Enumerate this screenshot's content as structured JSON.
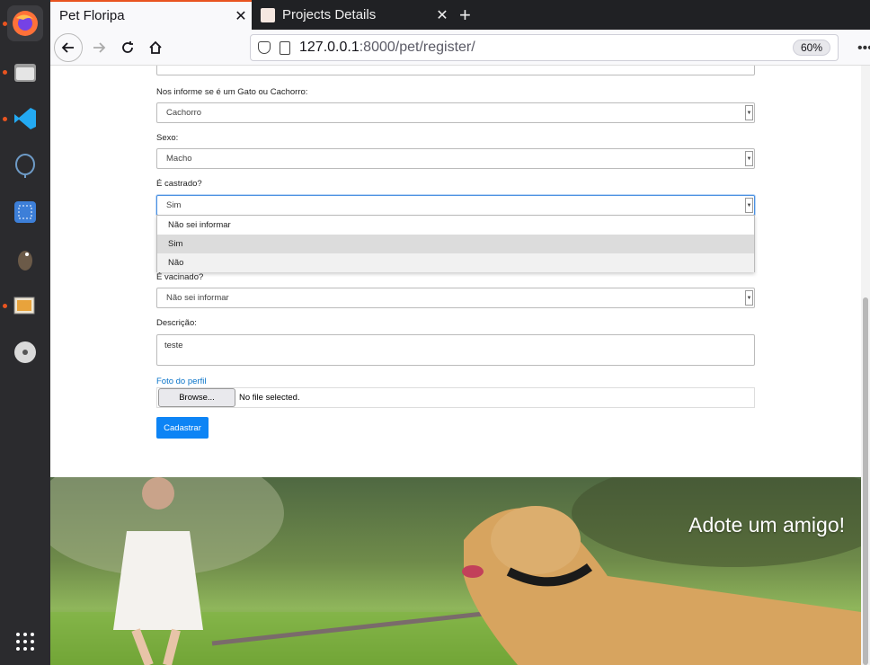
{
  "browser": {
    "tabs": [
      {
        "title": "Pet Floripa",
        "active": true
      },
      {
        "title": "Projects Details",
        "active": false
      }
    ],
    "url": {
      "host": "127.0.0.1",
      "path": ":8000/pet/register/"
    },
    "zoom": "60%"
  },
  "form": {
    "type_label": "Nos informe se é um Gato ou Cachorro:",
    "type_value": "Cachorro",
    "sex_label": "Sexo:",
    "sex_value": "Macho",
    "castrated_label": "É castrado?",
    "castrated_value": "Sim",
    "castrated_options": [
      "Não sei informar",
      "Sim",
      "Não"
    ],
    "vaccinated_label": "É vacinado?",
    "vaccinated_value": "Não sei informar",
    "description_label": "Descrição:",
    "description_value": "teste",
    "photo_label": "Foto do perfil",
    "browse_label": "Browse...",
    "file_status": "No file selected.",
    "submit_label": "Cadastrar"
  },
  "hero": {
    "title": "Adote um amigo!"
  },
  "colors": {
    "accent": "#e95420",
    "primary_button": "#0d84f5"
  }
}
